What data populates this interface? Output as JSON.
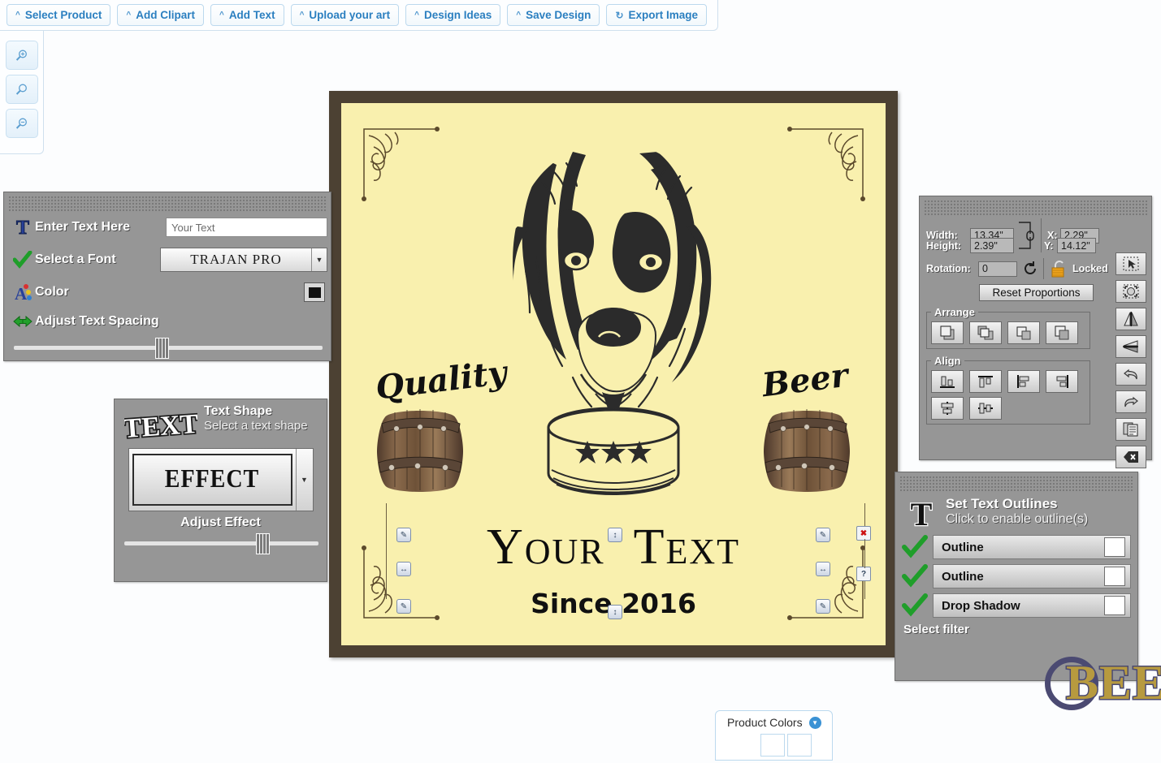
{
  "toolbar": {
    "buttons": [
      {
        "label": "Select Product",
        "icon": "caret-up-icon"
      },
      {
        "label": "Add Clipart",
        "icon": "caret-up-icon"
      },
      {
        "label": "Add Text",
        "icon": "caret-up-icon"
      },
      {
        "label": "Upload your art",
        "icon": "caret-up-icon"
      },
      {
        "label": "Design Ideas",
        "icon": "caret-up-icon"
      },
      {
        "label": "Save Design",
        "icon": "caret-up-icon"
      },
      {
        "label": "Export Image",
        "icon": "refresh-icon"
      }
    ]
  },
  "zoom_rail": {
    "buttons": [
      {
        "name": "zoom-in-icon"
      },
      {
        "name": "zoom-reset-icon"
      },
      {
        "name": "zoom-out-icon"
      }
    ]
  },
  "text_panel": {
    "enter_text_label": "Enter Text Here",
    "text_value": "Your Text",
    "text_placeholder": "Your Text",
    "font_label": "Select a Font",
    "font_value": "TRAJAN PRO",
    "color_label": "Color",
    "color_value": "#111111",
    "spacing_label": "Adjust Text Spacing",
    "spacing_percent": 48
  },
  "shape_panel": {
    "title": "Text Shape",
    "subtitle": "Select a text shape",
    "logo_word": "TEXT",
    "effect_value": "EFFECT",
    "adjust_label": "Adjust Effect",
    "adjust_percent": 71
  },
  "properties_panel": {
    "width_label": "Width:",
    "width_value": "13.34\"",
    "height_label": "Height:",
    "height_value": "2.39\"",
    "rotation_label": "Rotation:",
    "rotation_value": "0",
    "x_label": "X:",
    "x_value": "2.29\"",
    "y_label": "Y:",
    "y_value": "14.12\"",
    "locked_label": "Locked",
    "reset_label": "Reset Proportions",
    "arrange_label": "Arrange",
    "align_label": "Align",
    "arrange_buttons": [
      "bring-to-front-icon",
      "bring-forward-icon",
      "send-backward-icon",
      "send-to-back-icon"
    ],
    "align_buttons": [
      "align-bottom-icon",
      "align-top-icon",
      "align-left-icon",
      "align-right-icon",
      "center-horizontal-icon",
      "center-vertical-icon"
    ],
    "side_buttons": [
      "select-tool-icon",
      "transform-tool-icon",
      "flip-horizontal-icon",
      "flip-vertical-icon",
      "undo-icon",
      "redo-icon",
      "duplicate-icon",
      "delete-icon"
    ]
  },
  "outline_panel": {
    "title": "Set Text Outlines",
    "subtitle": "Click to enable outline(s)",
    "rows": [
      {
        "label": "Outline",
        "swatch": "#ffffff"
      },
      {
        "label": "Outline",
        "swatch": "#ffffff"
      },
      {
        "label": "Drop Shadow",
        "swatch": "#ffffff"
      }
    ],
    "select_filter_label": "Select filter"
  },
  "canvas": {
    "frame_color": "#4c4133",
    "board_color": "#f9f0ae",
    "word_left": "Quality",
    "word_right": "Beer",
    "main_text": "Y",
    "main_text_rest": "OUR",
    "main_text_t": "T",
    "main_text_ext": "EXT",
    "sub_text": "Since 2016",
    "stars": 3,
    "handles": {
      "delete": "✖",
      "rotate": "?"
    }
  },
  "product_colors": {
    "label": "Product Colors",
    "swatches": [
      "#ffffff",
      "#ffffff"
    ]
  },
  "brand": {
    "word": "BEE",
    "gold": "#b79a3f",
    "navy": "#4b4a72"
  }
}
